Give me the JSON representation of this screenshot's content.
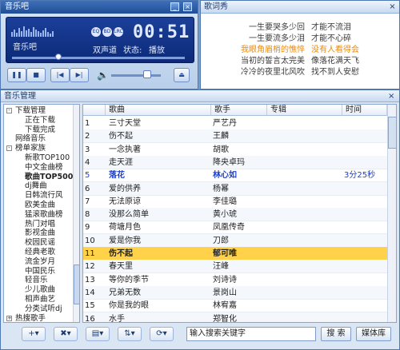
{
  "player": {
    "title": "音乐吧",
    "app_label": "音乐吧",
    "badges": [
      "EQ",
      "BD",
      "LRC"
    ],
    "time": "00:51",
    "channel": "双声道",
    "status_label": "状态:",
    "status": "播放",
    "progress": 0.27,
    "volume": 0.73,
    "buttons": [
      "pause",
      "stop",
      "prev",
      "next",
      "volume",
      "eject"
    ]
  },
  "lyrics": {
    "title": "歌词秀",
    "lines": [
      {
        "a": "一生要哭多少回",
        "b": "才能不流泪",
        "current": false
      },
      {
        "a": "一生要流多少泪",
        "b": "才能不心碎",
        "current": false
      },
      {
        "a": "我眼角眉梢的憔悴",
        "b": "没有人看得会",
        "current": true
      },
      {
        "a": "当初的誓言太完美",
        "b": "像落花满天飞",
        "current": false
      },
      {
        "a": "冷冷的夜里北风吹",
        "b": "找不到人安慰",
        "current": false
      }
    ]
  },
  "manager": {
    "title": "音乐管理",
    "tree": [
      {
        "label": "下载管理",
        "level": 0,
        "box": "-"
      },
      {
        "label": "正在下载",
        "level": 2
      },
      {
        "label": "下载完成",
        "level": 2
      },
      {
        "label": "网络音乐",
        "level": 1
      },
      {
        "label": "榜单家族",
        "level": 0,
        "box": "-"
      },
      {
        "label": "新歌TOP100",
        "level": 2
      },
      {
        "label": "中文金曲榜",
        "level": 2
      },
      {
        "label": "歌曲TOP500",
        "level": 2,
        "selected": true
      },
      {
        "label": "dj舞曲",
        "level": 2
      },
      {
        "label": "日韩流行风",
        "level": 2
      },
      {
        "label": "欧美金曲",
        "level": 2
      },
      {
        "label": "猛滚歌曲榜",
        "level": 2
      },
      {
        "label": "热门对唱",
        "level": 2
      },
      {
        "label": "影视金曲",
        "level": 2
      },
      {
        "label": "校园民谣",
        "level": 2
      },
      {
        "label": "经典老歌",
        "level": 2
      },
      {
        "label": "流金岁月",
        "level": 2
      },
      {
        "label": "中国民乐",
        "level": 2
      },
      {
        "label": "轻音乐",
        "level": 2
      },
      {
        "label": "少儿歌曲",
        "level": 2
      },
      {
        "label": "相声曲艺",
        "level": 2
      },
      {
        "label": "分类试听dj",
        "level": 2
      },
      {
        "label": "热搜歌手",
        "level": 0,
        "box": "+"
      }
    ],
    "columns": [
      "",
      "歌曲",
      "歌手",
      "专辑",
      "时间"
    ],
    "rows": [
      {
        "n": "1",
        "song": "三寸天堂",
        "artist": "严艺丹",
        "time": ""
      },
      {
        "n": "2",
        "song": "伤不起",
        "artist": "王麟",
        "time": ""
      },
      {
        "n": "3",
        "song": "一念执著",
        "artist": "胡歌",
        "time": ""
      },
      {
        "n": "4",
        "song": "走天涯",
        "artist": "降央卓玛",
        "time": ""
      },
      {
        "n": "5",
        "song": "落花",
        "artist": "林心如",
        "time": "3分25秒",
        "playing": true
      },
      {
        "n": "6",
        "song": "爱的供养",
        "artist": "杨幂",
        "time": ""
      },
      {
        "n": "7",
        "song": "无法原谅",
        "artist": "李佳璐",
        "time": ""
      },
      {
        "n": "8",
        "song": "没那么简单",
        "artist": "黄小琥",
        "time": ""
      },
      {
        "n": "9",
        "song": "荷塘月色",
        "artist": "凤凰传奇",
        "time": ""
      },
      {
        "n": "10",
        "song": "爱是你我",
        "artist": "刀郎",
        "time": ""
      },
      {
        "n": "11",
        "song": "伤不起",
        "artist": "郁可唯",
        "time": "",
        "highlight": true
      },
      {
        "n": "12",
        "song": "春天里",
        "artist": "汪峰",
        "time": ""
      },
      {
        "n": "13",
        "song": "等你的季节",
        "artist": "刘诗诗",
        "time": ""
      },
      {
        "n": "14",
        "song": "兄弟无数",
        "artist": "景岗山",
        "time": ""
      },
      {
        "n": "15",
        "song": "你是我的眼",
        "artist": "林宥嘉",
        "time": ""
      },
      {
        "n": "16",
        "song": "水手",
        "artist": "郑智化",
        "time": ""
      }
    ]
  },
  "toolbar": {
    "buttons": [
      {
        "name": "add",
        "label": "+▾"
      },
      {
        "name": "delete",
        "label": "✖▾"
      },
      {
        "name": "list",
        "label": "▤▾"
      },
      {
        "name": "sort",
        "label": "⇅▾"
      },
      {
        "name": "loop",
        "label": "⟳▾"
      }
    ],
    "search_placeholder": "输入搜索关键字",
    "search_button": "搜 索",
    "library_button": "媒体库"
  },
  "colors": {
    "titlebar": "#1f4e97",
    "lcd": "#0c2a78",
    "highlight": "#ffd24a",
    "playing_text": "#1d3fc9",
    "current_lyric": "#f08a00"
  }
}
